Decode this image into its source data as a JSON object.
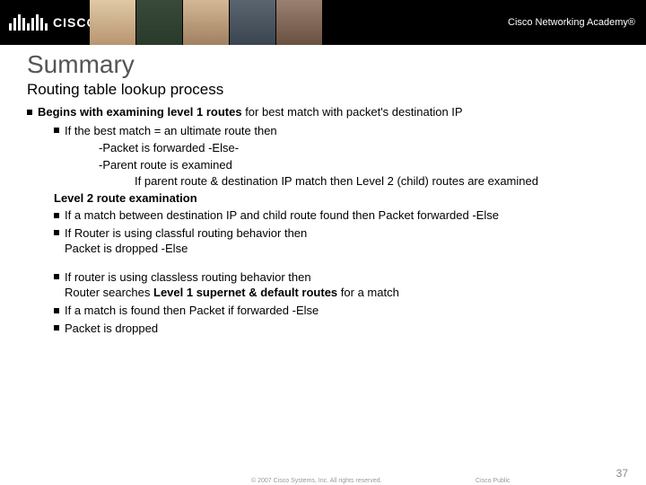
{
  "header": {
    "logo_text": "CISCO",
    "academy_text": "Cisco Networking Academy®"
  },
  "title": "Summary",
  "subtitle": "Routing table lookup process",
  "bullets": {
    "b1_prefix": "Begins with examining level 1 routes",
    "b1_suffix": " for best match with packet's destination IP",
    "b1_1": "If the best match = an ultimate route then",
    "b1_1a": "-Packet is forwarded  -Else-",
    "b1_1b": "-Parent route is examined",
    "b1_1b_i": "If parent route & destination IP match then Level 2 (child) routes are examined",
    "b1_2": "Level 2 route examination",
    "b1_3": "If a match between destination IP and child route found then Packet forwarded -Else",
    "b1_4": "If Router is using classful routing behavior then",
    "b1_4a": "Packet is dropped -Else",
    "b2_1_prefix": "If router is using classless routing behavior then",
    "b2_1_mid": "Router searches ",
    "b2_1_bold": "Level 1 supernet & default routes",
    "b2_1_suffix": " for a match",
    "b2_2": "If a match is found then Packet if forwarded -Else",
    "b2_3": "Packet is dropped"
  },
  "footer": {
    "copyright": "© 2007 Cisco Systems, Inc. All rights reserved.",
    "public": "Cisco Public",
    "page": "37"
  }
}
